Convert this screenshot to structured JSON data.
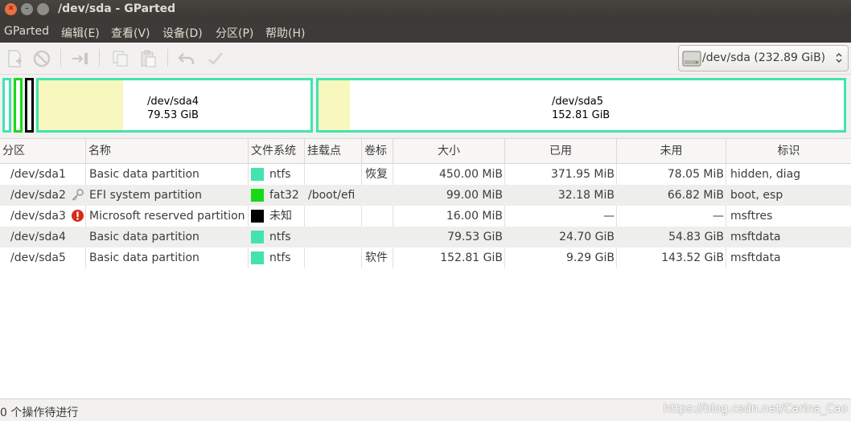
{
  "window": {
    "title": "/dev/sda - GParted"
  },
  "menu": [
    "GParted",
    "编辑(E)",
    "查看(V)",
    "设备(D)",
    "分区(P)",
    "帮助(H)"
  ],
  "toolbar": {
    "icons": [
      "new-partition-icon",
      "delete-partition-icon",
      "resize-move-icon",
      "copy-icon",
      "paste-icon",
      "undo-icon",
      "apply-icon"
    ]
  },
  "device": {
    "label": "/dev/sda   (232.89 GiB)"
  },
  "visual": {
    "sda4": {
      "name": "/dev/sda4",
      "size": "79.53 GiB",
      "used_fraction": 0.31
    },
    "sda5": {
      "name": "/dev/sda5",
      "size": "152.81 GiB",
      "used_fraction": 0.06
    },
    "colors": {
      "ntfs": "#42e3b0",
      "fat32": "#18d918",
      "unknown": "#000000",
      "used": "#f8f8be"
    }
  },
  "table": {
    "headers": [
      "分区",
      "名称",
      "文件系统",
      "挂载点",
      "卷标",
      "大小",
      "已用",
      "未用",
      "标识"
    ],
    "rows": [
      {
        "partition": "/dev/sda1",
        "name": "Basic data partition",
        "fs": "ntfs",
        "mount": "",
        "label": "恢复",
        "size": "450.00 MiB",
        "used": "371.95 MiB",
        "unused": "78.05 MiB",
        "flags": "hidden, diag",
        "fs_color": "#42e3b0",
        "icon": ""
      },
      {
        "partition": "/dev/sda2",
        "name": "EFI system partition",
        "fs": "fat32",
        "mount": "/boot/efi",
        "label": "",
        "size": "99.00 MiB",
        "used": "32.18 MiB",
        "unused": "66.82 MiB",
        "flags": "boot, esp",
        "fs_color": "#18d918",
        "icon": "key-icon"
      },
      {
        "partition": "/dev/sda3",
        "name": "Microsoft reserved partition",
        "fs": "未知",
        "mount": "",
        "label": "",
        "size": "16.00 MiB",
        "used": "—",
        "unused": "—",
        "flags": "msftres",
        "fs_color": "#000000",
        "icon": "error-icon"
      },
      {
        "partition": "/dev/sda4",
        "name": "Basic data partition",
        "fs": "ntfs",
        "mount": "",
        "label": "",
        "size": "79.53 GiB",
        "used": "24.70 GiB",
        "unused": "54.83 GiB",
        "flags": "msftdata",
        "fs_color": "#42e3b0",
        "icon": ""
      },
      {
        "partition": "/dev/sda5",
        "name": "Basic data partition",
        "fs": "ntfs",
        "mount": "",
        "label": "软件",
        "size": "152.81 GiB",
        "used": "9.29 GiB",
        "unused": "143.52 GiB",
        "flags": "msftdata",
        "fs_color": "#42e3b0",
        "icon": ""
      }
    ]
  },
  "status": {
    "text": "0 个操作待进行",
    "watermark": "https://blog.csdn.net/Carina_Cao"
  }
}
